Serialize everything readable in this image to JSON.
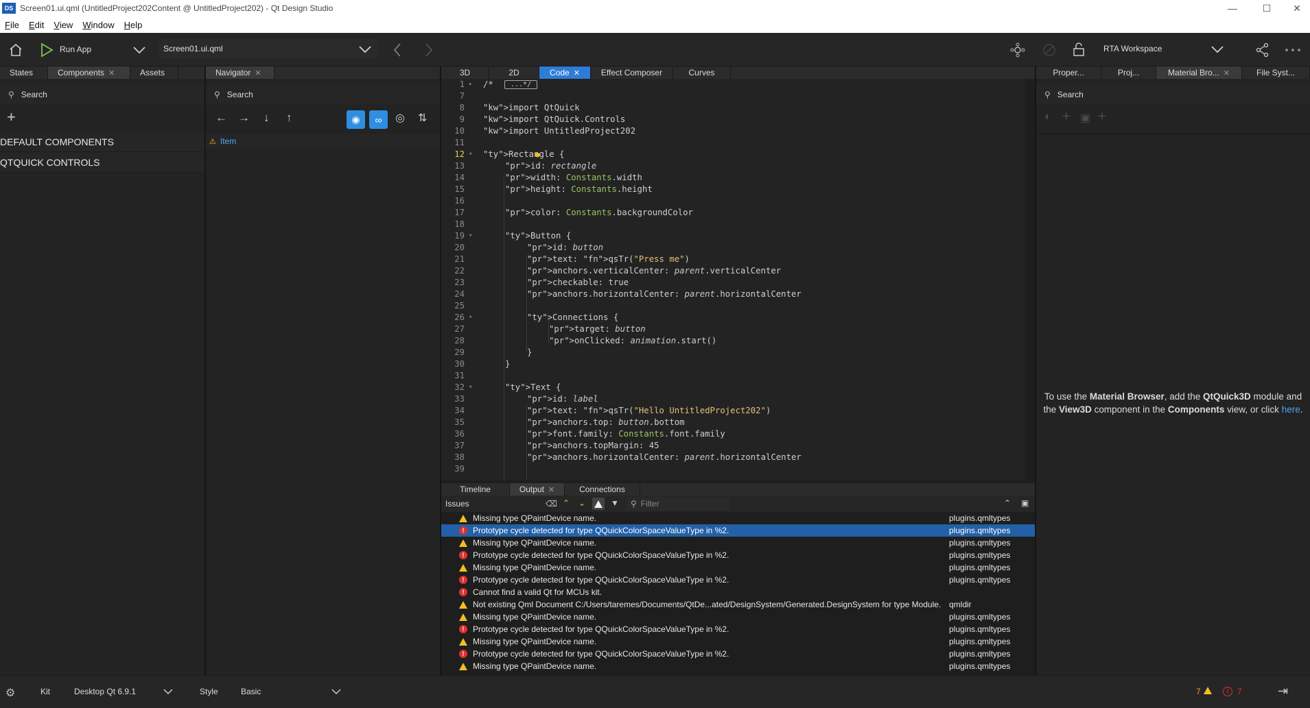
{
  "window": {
    "title": "Screen01.ui.qml (UntitledProject202Content @ UntitledProject202) - Qt Design Studio",
    "badge": "DS"
  },
  "menu": [
    {
      "accel": "F",
      "rest": "ile"
    },
    {
      "accel": "E",
      "rest": "dit"
    },
    {
      "accel": "V",
      "rest": "iew"
    },
    {
      "accel": "W",
      "rest": "indow"
    },
    {
      "accel": "H",
      "rest": "elp"
    }
  ],
  "toolbar": {
    "run_label": "Run App",
    "document": "Screen01.ui.qml",
    "workspace": "RTA Workspace"
  },
  "left": {
    "tabs": [
      "States",
      "Components",
      "Assets"
    ],
    "search_placeholder": "Search",
    "sections": [
      "DEFAULT COMPONENTS",
      "QTQUICK CONTROLS"
    ]
  },
  "navigator": {
    "tab": "Navigator",
    "search_placeholder": "Search",
    "item": "Item"
  },
  "editor": {
    "tabs": [
      "3D",
      "2D",
      "Code",
      "Effect Composer",
      "Curves"
    ],
    "active_tab": "Code",
    "current_line": "12",
    "lines": [
      {
        "n": "1",
        "t": "/* "
      },
      {
        "n": "7",
        "t": ""
      },
      {
        "n": "8",
        "t": "import QtQuick"
      },
      {
        "n": "9",
        "t": "import QtQuick.Controls"
      },
      {
        "n": "10",
        "t": "import UntitledProject202"
      },
      {
        "n": "11",
        "t": ""
      },
      {
        "n": "12",
        "t": "Rectangle {"
      },
      {
        "n": "13",
        "t": "id: rectangle"
      },
      {
        "n": "14",
        "t": "width: Constants.width"
      },
      {
        "n": "15",
        "t": "height: Constants.height"
      },
      {
        "n": "16",
        "t": ""
      },
      {
        "n": "17",
        "t": "color: Constants.backgroundColor"
      },
      {
        "n": "18",
        "t": ""
      },
      {
        "n": "19",
        "t": "Button {"
      },
      {
        "n": "20",
        "t": "id: button"
      },
      {
        "n": "21",
        "t": "text: qsTr(\"Press me\")"
      },
      {
        "n": "22",
        "t": "anchors.verticalCenter: parent.verticalCenter"
      },
      {
        "n": "23",
        "t": "checkable: true"
      },
      {
        "n": "24",
        "t": "anchors.horizontalCenter: parent.horizontalCenter"
      },
      {
        "n": "25",
        "t": ""
      },
      {
        "n": "26",
        "t": "Connections {"
      },
      {
        "n": "27",
        "t": "target: button"
      },
      {
        "n": "28",
        "t": "onClicked: animation.start()"
      },
      {
        "n": "29",
        "t": "}"
      },
      {
        "n": "30",
        "t": "}"
      },
      {
        "n": "31",
        "t": ""
      },
      {
        "n": "32",
        "t": "Text {"
      },
      {
        "n": "33",
        "t": "id: label"
      },
      {
        "n": "34",
        "t": "text: qsTr(\"Hello UntitledProject202\")"
      },
      {
        "n": "35",
        "t": "anchors.top: button.bottom"
      },
      {
        "n": "36",
        "t": "font.family: Constants.font.family"
      },
      {
        "n": "37",
        "t": "anchors.topMargin: 45"
      },
      {
        "n": "38",
        "t": "anchors.horizontalCenter: parent.horizontalCenter"
      },
      {
        "n": "39",
        "t": ""
      }
    ],
    "collapsed_marker": "...*/"
  },
  "bottom": {
    "tabs": [
      "Timeline",
      "Output",
      "Connections"
    ],
    "issues_label": "Issues",
    "filter_placeholder": "Filter",
    "issues": [
      {
        "type": "warning",
        "message": "Missing type QPaintDevice name.",
        "file": "plugins.qmltypes"
      },
      {
        "type": "error",
        "message": "Prototype cycle detected for type QQuickColorSpaceValueType in %2.",
        "file": "plugins.qmltypes",
        "selected": true
      },
      {
        "type": "warning",
        "message": "Missing type QPaintDevice name.",
        "file": "plugins.qmltypes"
      },
      {
        "type": "error",
        "message": "Prototype cycle detected for type QQuickColorSpaceValueType in %2.",
        "file": "plugins.qmltypes"
      },
      {
        "type": "warning",
        "message": "Missing type QPaintDevice name.",
        "file": "plugins.qmltypes"
      },
      {
        "type": "error",
        "message": "Prototype cycle detected for type QQuickColorSpaceValueType in %2.",
        "file": "plugins.qmltypes"
      },
      {
        "type": "error",
        "message": "Cannot find a valid Qt for MCUs kit.",
        "file": ""
      },
      {
        "type": "warning",
        "message": "Not existing Qml Document C:/Users/taremes/Documents/QtDe...ated/DesignSystem/Generated.DesignSystem for type Module.",
        "file": "qmldir"
      },
      {
        "type": "warning",
        "message": "Missing type QPaintDevice name.",
        "file": "plugins.qmltypes"
      },
      {
        "type": "error",
        "message": "Prototype cycle detected for type QQuickColorSpaceValueType in %2.",
        "file": "plugins.qmltypes"
      },
      {
        "type": "warning",
        "message": "Missing type QPaintDevice name.",
        "file": "plugins.qmltypes"
      },
      {
        "type": "error",
        "message": "Prototype cycle detected for type QQuickColorSpaceValueType in %2.",
        "file": "plugins.qmltypes"
      },
      {
        "type": "warning",
        "message": "Missing type QPaintDevice name.",
        "file": "plugins.qmltypes"
      }
    ]
  },
  "right": {
    "tabs": [
      "Proper...",
      "Proj...",
      "Material Bro...",
      "File Syst..."
    ],
    "search_placeholder": "Search",
    "msg_1": "To use the ",
    "msg_b1": "Material Browser",
    "msg_2": ", add the ",
    "msg_b2": "QtQuick3D",
    "msg_3": " module and the ",
    "msg_b3": "View3D",
    "msg_4": " component in the ",
    "msg_b4": "Components",
    "msg_5": " view, or click ",
    "msg_link": "here",
    "msg_6": "."
  },
  "status": {
    "kit_label": "Kit",
    "kit_value": "Desktop Qt 6.9.1",
    "style_label": "Style",
    "style_value": "Basic",
    "warnings": "7",
    "errors": "7"
  },
  "colors": {
    "accent": "#2e7cd6",
    "warning": "#f0c020",
    "error": "#e03030"
  }
}
